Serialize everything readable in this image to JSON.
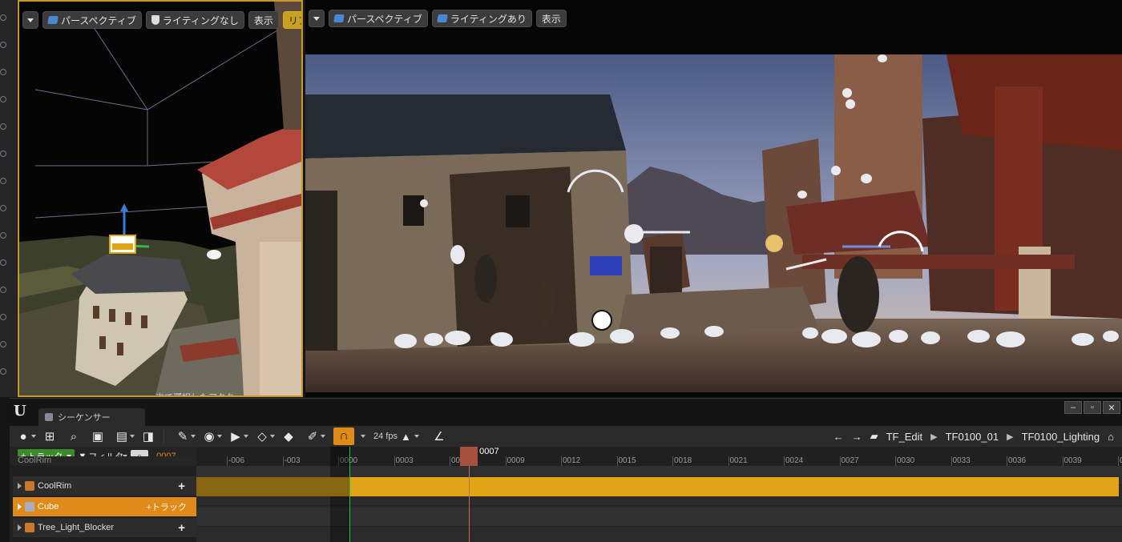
{
  "viewport_left": {
    "toolbar": {
      "menu_caret": "chevron-down-icon",
      "perspective_label": "パースペクティブ",
      "lighting_label": "ライティングなし",
      "show_label": "表示",
      "realtime_label": "リアルタイム"
    },
    "caption": "次で選択したアクタ"
  },
  "viewport_right": {
    "toolbar": {
      "perspective_label": "パースペクティブ",
      "lighting_label": "ライティングあり",
      "show_label": "表示"
    }
  },
  "sequencer": {
    "tab_title": "シーケンサー",
    "window_buttons": [
      "–",
      "▫",
      "✕"
    ],
    "fps_label": "24 fps",
    "breadcrumb": [
      "TF_Edit",
      "TF0100_01",
      "TF0100_Lighting"
    ],
    "add_track_label": "トラック",
    "filter_label": "フィルタ",
    "current_frame": "0007",
    "playhead_label": "0007",
    "ruler_ticks": [
      "-006",
      "-003",
      "0000",
      "0003",
      "0006",
      "0009",
      "0012",
      "0015",
      "0018",
      "0021",
      "0024",
      "0027",
      "0030",
      "0033",
      "0036",
      "0039",
      "00"
    ],
    "tracks": [
      {
        "name": "CoolRim",
        "selected": false,
        "action": "+"
      },
      {
        "name": "Cube",
        "selected": true,
        "action": "+トラック"
      },
      {
        "name": "Tree_Light_Blocker",
        "selected": false,
        "action": "+"
      }
    ],
    "partial_track_above": "CoolRim",
    "colors": {
      "accent": "#e08a1a",
      "track_bar": "#e0a516",
      "add_button": "#3d8a2a",
      "playhead": "#a65040"
    }
  }
}
